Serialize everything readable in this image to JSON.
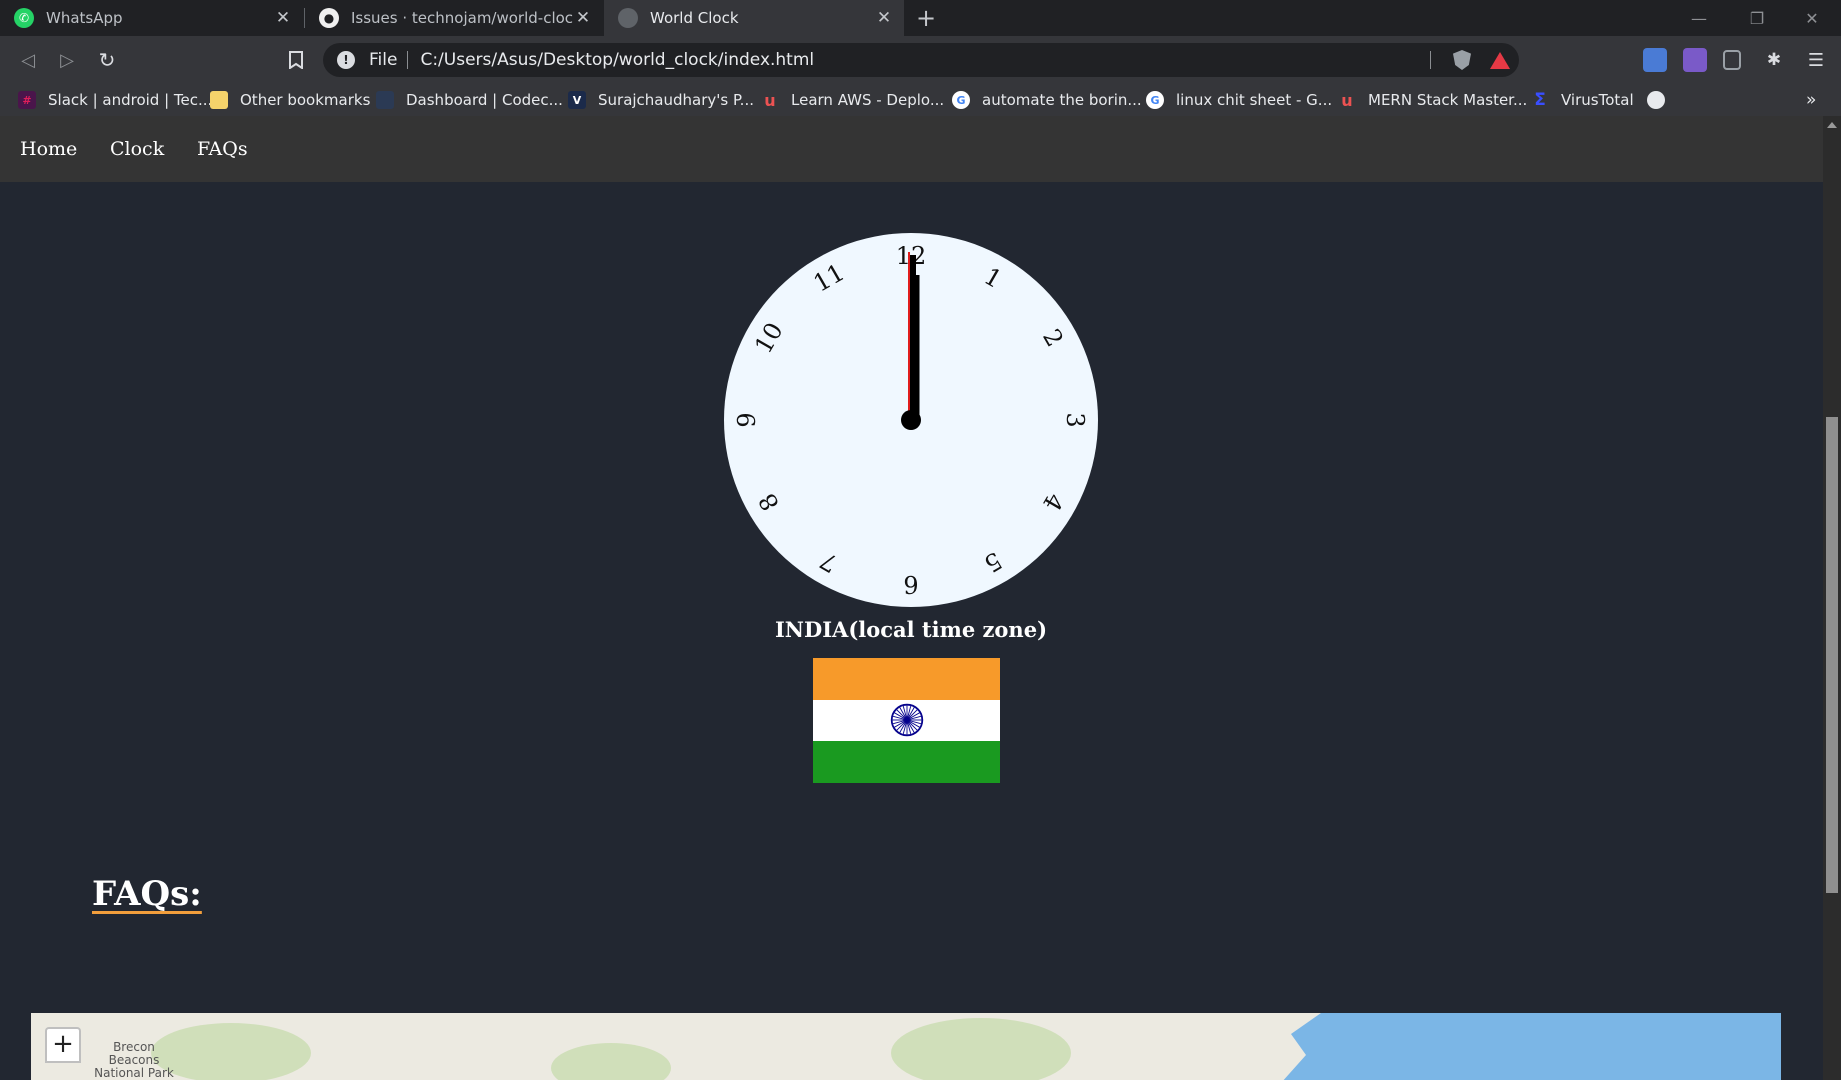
{
  "browser": {
    "tabs": [
      {
        "title": "WhatsApp",
        "icon": "whatsapp-icon",
        "active": false
      },
      {
        "title": "Issues · technojam/world-clock",
        "icon": "github-icon",
        "active": false
      },
      {
        "title": "World Clock",
        "icon": "globe-icon",
        "active": true
      }
    ],
    "new_tab_label": "+",
    "close_label": "✕",
    "window": {
      "minimize": "—",
      "restore": "❐",
      "close": "✕"
    },
    "address": {
      "scheme": "File",
      "url": "C:/Users/Asus/Desktop/world_clock/index.html"
    },
    "nav": {
      "back": "◁",
      "forward": "▷",
      "reload": "↻",
      "bookmark": "🔖"
    },
    "bookmarks": [
      {
        "label": "Slack | android | Tec...",
        "icon": "slack-icon",
        "color": "#4a154b",
        "glyph": "#"
      },
      {
        "label": "Other bookmarks",
        "icon": "folder-icon",
        "color": "#f5d36b",
        "glyph": ""
      },
      {
        "label": "Dashboard | Codec...",
        "icon": "codecademy-icon",
        "color": "#2b3a54",
        "glyph": ""
      },
      {
        "label": "Surajchaudhary's P...",
        "icon": "v-icon",
        "color": "#1b2a4a",
        "glyph": "V"
      },
      {
        "label": "Learn AWS - Deplo...",
        "icon": "udemy-icon",
        "color": "#35363a",
        "glyph": "u"
      },
      {
        "label": "automate the borin...",
        "icon": "google-icon",
        "color": "#ffffff",
        "glyph": "G"
      },
      {
        "label": "linux chit sheet - G...",
        "icon": "google-icon",
        "color": "#ffffff",
        "glyph": "G"
      },
      {
        "label": "MERN Stack Master...",
        "icon": "udemy-icon",
        "color": "#35363a",
        "glyph": "u"
      },
      {
        "label": "VirusTotal",
        "icon": "virustotal-icon",
        "color": "#394eff",
        "glyph": "Σ"
      }
    ],
    "bookmarks_more": "»"
  },
  "site": {
    "nav": [
      "Home",
      "Clock",
      "FAQs"
    ],
    "clock": {
      "numerals": [
        "12",
        "1",
        "2",
        "3",
        "4",
        "5",
        "6",
        "7",
        "8",
        "9",
        "10",
        "11"
      ],
      "time": {
        "hour": 12,
        "minute": 0,
        "second": 0
      },
      "colors": {
        "face": "#f0f8ff",
        "hands": "#000000",
        "second_hand": "#e11d1d"
      }
    },
    "timezone_label": "INDIA(local time zone)",
    "flag": {
      "colors": [
        "#f79a2a",
        "#ffffff",
        "#1a9a20"
      ],
      "chakra": "#06038d"
    },
    "faq_heading": "FAQs:",
    "map": {
      "zoom_in": "+",
      "place_label": "Brecon Beacons National Park"
    }
  }
}
